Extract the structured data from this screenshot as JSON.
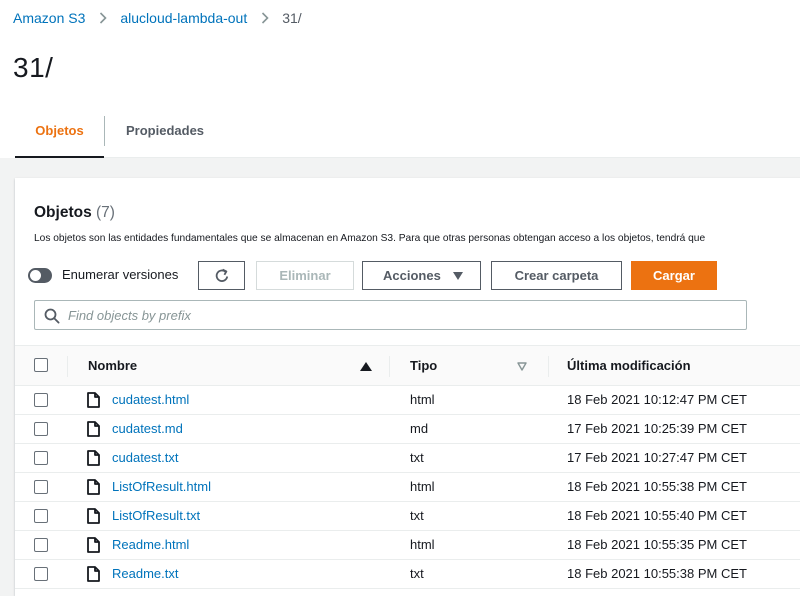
{
  "breadcrumb": {
    "items": [
      "Amazon S3",
      "alucloud-lambda-out"
    ],
    "current": "31/"
  },
  "page_title": "31/",
  "tabs": [
    {
      "label": "Objetos",
      "active": true
    },
    {
      "label": "Propiedades",
      "active": false
    }
  ],
  "panel": {
    "title": "Objetos",
    "count": "(7)",
    "description": "Los objetos son las entidades fundamentales que se almacenan en Amazon S3. Para que otras personas obtengan acceso a los objetos, tendrá que"
  },
  "toolbar": {
    "toggle_label": "Enumerar versiones",
    "toggle_on": false,
    "delete_label": "Eliminar",
    "actions_label": "Acciones",
    "create_folder_label": "Crear carpeta",
    "upload_label": "Cargar"
  },
  "search": {
    "placeholder": "Find objects by prefix",
    "value": ""
  },
  "table": {
    "columns": [
      "Nombre",
      "Tipo",
      "Última modificación"
    ],
    "rows": [
      {
        "name": "cudatest.html",
        "type": "html",
        "modified": "18 Feb 2021 10:12:47 PM CET"
      },
      {
        "name": "cudatest.md",
        "type": "md",
        "modified": "17 Feb 2021 10:25:39 PM CET"
      },
      {
        "name": "cudatest.txt",
        "type": "txt",
        "modified": "17 Feb 2021 10:27:47 PM CET"
      },
      {
        "name": "ListOfResult.html",
        "type": "html",
        "modified": "18 Feb 2021 10:55:38 PM CET"
      },
      {
        "name": "ListOfResult.txt",
        "type": "txt",
        "modified": "18 Feb 2021 10:55:40 PM CET"
      },
      {
        "name": "Readme.html",
        "type": "html",
        "modified": "18 Feb 2021 10:55:35 PM CET"
      },
      {
        "name": "Readme.txt",
        "type": "txt",
        "modified": "18 Feb 2021 10:55:38 PM CET"
      }
    ]
  },
  "icons": {
    "breadcrumb_separator": "chevron-right-icon",
    "refresh": "refresh-icon",
    "actions_caret": "caret-down-icon",
    "search": "search-icon",
    "sort_active": "sort-ascending-icon",
    "sort_inactive": "sort-icon",
    "file": "file-icon"
  },
  "colors": {
    "accent": "#ec7211",
    "link": "#0073bb",
    "text": "#16191f",
    "secondary": "#545b64"
  }
}
